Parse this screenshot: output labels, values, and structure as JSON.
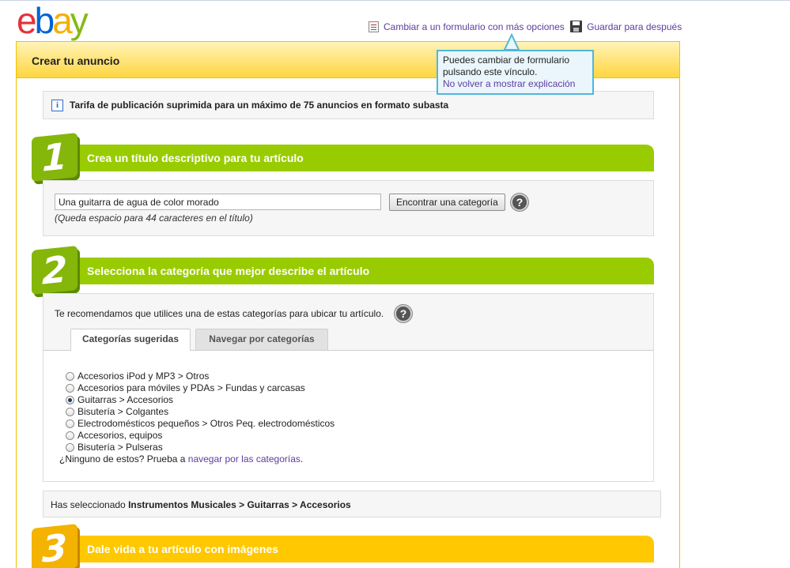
{
  "header": {
    "logo_letters": [
      "e",
      "b",
      "a",
      "y"
    ],
    "switch_form_link": "Cambiar a un formulario con más opciones",
    "save_later_link": "Guardar para después"
  },
  "tooltip": {
    "text_line1": "Puedes cambiar de formulario",
    "text_line2": "pulsando este vínculo.",
    "dismiss_link": "No volver a mostrar explicación"
  },
  "panel": {
    "title": "Crear tu anuncio"
  },
  "info": {
    "icon": "i",
    "text": "Tarifa de publicación suprimida para un máximo de 75 anuncios en formato subasta"
  },
  "step1": {
    "number": "1",
    "title": "Crea un título descriptivo para tu artículo",
    "title_value": "Una guitarra de agua de color morado",
    "find_category_button": "Encontrar una categoría",
    "hint": "(Queda espacio para 44 caracteres en el título)",
    "help_icon": "?"
  },
  "step2": {
    "number": "2",
    "title": "Selecciona la categoría que mejor describe el artículo",
    "recommend_text": "Te recomendamos que utilices una de estas categorías para ubicar tu artículo.",
    "help_icon": "?",
    "tabs": [
      {
        "label": "Categorías sugeridas",
        "active": true
      },
      {
        "label": "Navegar por categorías",
        "active": false
      }
    ],
    "categories": [
      {
        "label": "Accesorios iPod y MP3 > Otros",
        "checked": false
      },
      {
        "label": "Accesorios para móviles y PDAs > Fundas y carcasas",
        "checked": false
      },
      {
        "label": "Guitarras > Accesorios",
        "checked": true
      },
      {
        "label": "Bisutería > Colgantes",
        "checked": false
      },
      {
        "label": "Electrodomésticos pequeños > Otros Peq. electrodomésticos",
        "checked": false
      },
      {
        "label": "Accesorios, equipos",
        "checked": false
      },
      {
        "label": "Bisutería > Pulseras",
        "checked": false
      }
    ],
    "none_prefix": "¿Ninguno de estos? Prueba a ",
    "none_link": "navegar por las categorías",
    "none_suffix": "."
  },
  "selection": {
    "prefix": "Has seleccionado ",
    "path": "Instrumentos Musicales > Guitarras > Accesorios"
  },
  "step3": {
    "number": "3",
    "title": "Dale vida a tu artículo con imágenes"
  },
  "colors": {
    "step_green": "#99cc00",
    "step_yellow": "#ffc800",
    "link_purple": "#5f3c9e",
    "tooltip_border": "#4fb7dd"
  }
}
